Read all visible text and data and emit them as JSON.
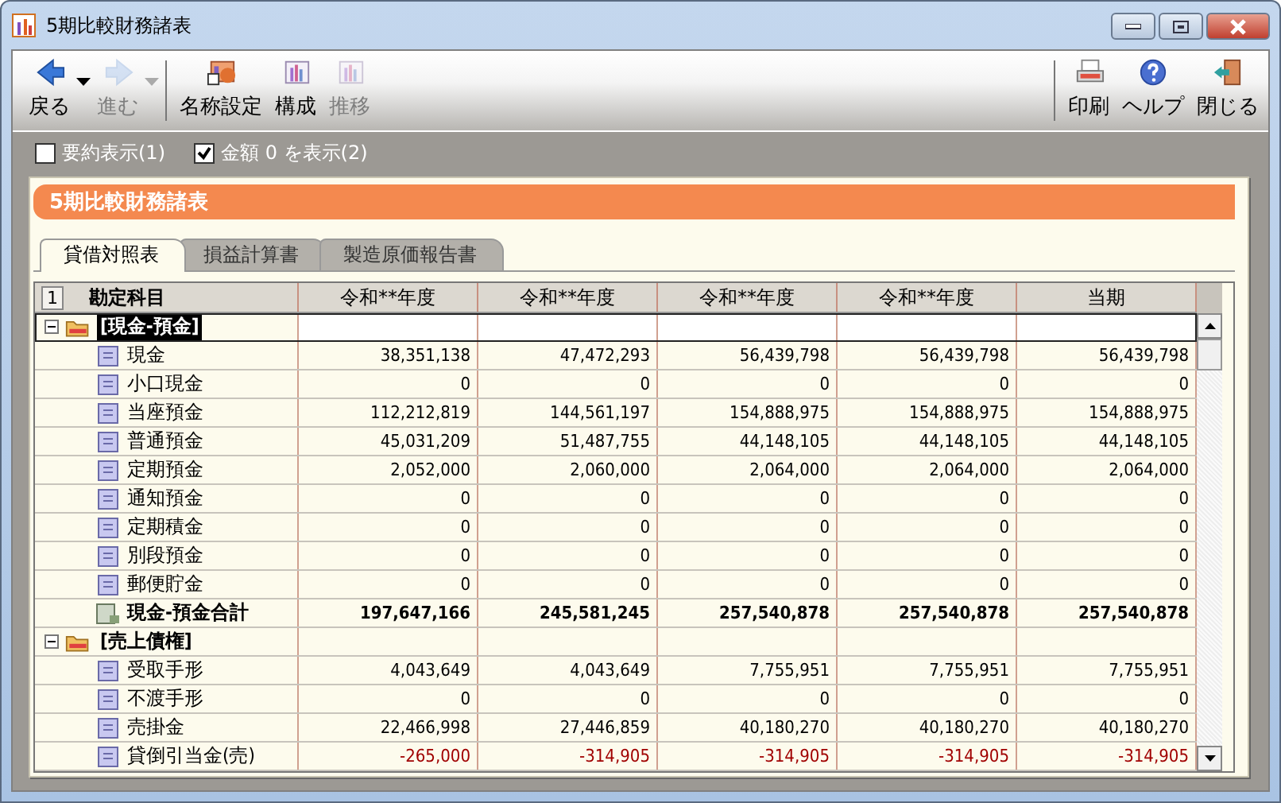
{
  "window": {
    "title": "5期比較財務諸表"
  },
  "toolbar": {
    "left": [
      {
        "label": "戻る",
        "disabled": false,
        "dropdown": true
      },
      {
        "label": "進む",
        "disabled": true,
        "dropdown": true
      },
      {
        "label": "名称設定",
        "disabled": false,
        "dropdown": false
      },
      {
        "label": "構成",
        "disabled": false,
        "dropdown": false
      },
      {
        "label": "推移",
        "disabled": true,
        "dropdown": false
      }
    ],
    "right": [
      {
        "label": "印刷",
        "disabled": false,
        "dropdown": false
      },
      {
        "label": "ヘルプ",
        "disabled": false,
        "dropdown": false
      },
      {
        "label": "閉じる",
        "disabled": false,
        "dropdown": false
      }
    ]
  },
  "options": [
    {
      "label": "要約表示(1)",
      "checked": false
    },
    {
      "label": "金額 0 を表示(2)",
      "checked": true
    }
  ],
  "panel": {
    "title": "5期比較財務諸表"
  },
  "tabs": [
    {
      "label": "貸借対照表",
      "selected": true
    },
    {
      "label": "損益計算書",
      "selected": false
    },
    {
      "label": "製造原価報告書",
      "selected": false
    }
  ],
  "table": {
    "level_button": "1",
    "columns": [
      "勘定科目",
      "令和**年度",
      "令和**年度",
      "令和**年度",
      "令和**年度",
      "当期"
    ],
    "rows": [
      {
        "label": "[現金-預金]",
        "expanded": true,
        "selected": true,
        "children": [
          {
            "kind": "item",
            "label": "現金",
            "values": [
              "38,351,138",
              "47,472,293",
              "56,439,798",
              "56,439,798",
              "56,439,798"
            ]
          },
          {
            "kind": "item",
            "label": "小口現金",
            "values": [
              "0",
              "0",
              "0",
              "0",
              "0"
            ]
          },
          {
            "kind": "item",
            "label": "当座預金",
            "values": [
              "112,212,819",
              "144,561,197",
              "154,888,975",
              "154,888,975",
              "154,888,975"
            ]
          },
          {
            "kind": "item",
            "label": "普通預金",
            "values": [
              "45,031,209",
              "51,487,755",
              "44,148,105",
              "44,148,105",
              "44,148,105"
            ]
          },
          {
            "kind": "item",
            "label": "定期預金",
            "values": [
              "2,052,000",
              "2,060,000",
              "2,064,000",
              "2,064,000",
              "2,064,000"
            ]
          },
          {
            "kind": "item",
            "label": "通知預金",
            "values": [
              "0",
              "0",
              "0",
              "0",
              "0"
            ]
          },
          {
            "kind": "item",
            "label": "定期積金",
            "values": [
              "0",
              "0",
              "0",
              "0",
              "0"
            ]
          },
          {
            "kind": "item",
            "label": "別段預金",
            "values": [
              "0",
              "0",
              "0",
              "0",
              "0"
            ]
          },
          {
            "kind": "item",
            "label": "郵便貯金",
            "values": [
              "0",
              "0",
              "0",
              "0",
              "0"
            ]
          },
          {
            "kind": "total",
            "label": "現金-預金合計",
            "values": [
              "197,647,166",
              "245,581,245",
              "257,540,878",
              "257,540,878",
              "257,540,878"
            ]
          }
        ]
      },
      {
        "label": "[売上債権]",
        "expanded": true,
        "selected": false,
        "children": [
          {
            "kind": "item",
            "label": "受取手形",
            "values": [
              "4,043,649",
              "4,043,649",
              "7,755,951",
              "7,755,951",
              "7,755,951"
            ]
          },
          {
            "kind": "item",
            "label": "不渡手形",
            "values": [
              "0",
              "0",
              "0",
              "0",
              "0"
            ]
          },
          {
            "kind": "item",
            "label": "売掛金",
            "values": [
              "22,466,998",
              "27,446,859",
              "40,180,270",
              "40,180,270",
              "40,180,270"
            ]
          },
          {
            "kind": "contra",
            "label": "貸倒引当金(売)",
            "values": [
              "-265,000",
              "-314,905",
              "-314,905",
              "-314,905",
              "-314,905"
            ]
          }
        ]
      }
    ]
  }
}
